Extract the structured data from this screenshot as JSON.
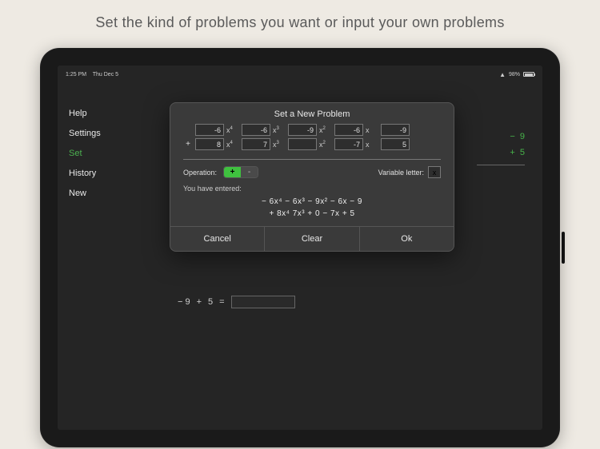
{
  "caption": "Set the kind of problems you want or input your own problems",
  "statusbar": {
    "time": "1:25 PM",
    "date": "Thu Dec 5",
    "battery_pct": "98%"
  },
  "nav": {
    "items": [
      {
        "label": "Help",
        "active": false
      },
      {
        "label": "Settings",
        "active": false
      },
      {
        "label": "Set",
        "active": true
      },
      {
        "label": "History",
        "active": false
      },
      {
        "label": "New",
        "active": false
      }
    ]
  },
  "dialog": {
    "title": "Set a New Problem",
    "row1_lead": "",
    "row2_lead": "+",
    "term_labels": [
      "x⁴",
      "x³",
      "x²",
      "x",
      ""
    ],
    "row1": [
      "-6",
      "-6",
      "-9",
      "-6",
      "-9"
    ],
    "row2": [
      "8",
      "7",
      "",
      "-7",
      "5"
    ],
    "operation_label": "Operation:",
    "toggle_plus": "+",
    "toggle_minus": "-",
    "variable_label": "Variable letter:",
    "variable_value": "x",
    "entered_label": "You have entered:",
    "poly1": "−  6x⁴  −  6x³  −  9x²  −  6x  −   9",
    "poly2": "+      8x⁴     7x³  +  0   −  7x  +  5",
    "buttons": {
      "cancel": "Cancel",
      "clear": "Clear",
      "ok": "Ok"
    }
  },
  "bg": {
    "line1_sign": "−",
    "line1_val": "9",
    "line2_sign": "+",
    "line2_val": "5",
    "bottom_left": "−  9",
    "bottom_plus": "+",
    "bottom_right": "5",
    "bottom_eq": "="
  }
}
